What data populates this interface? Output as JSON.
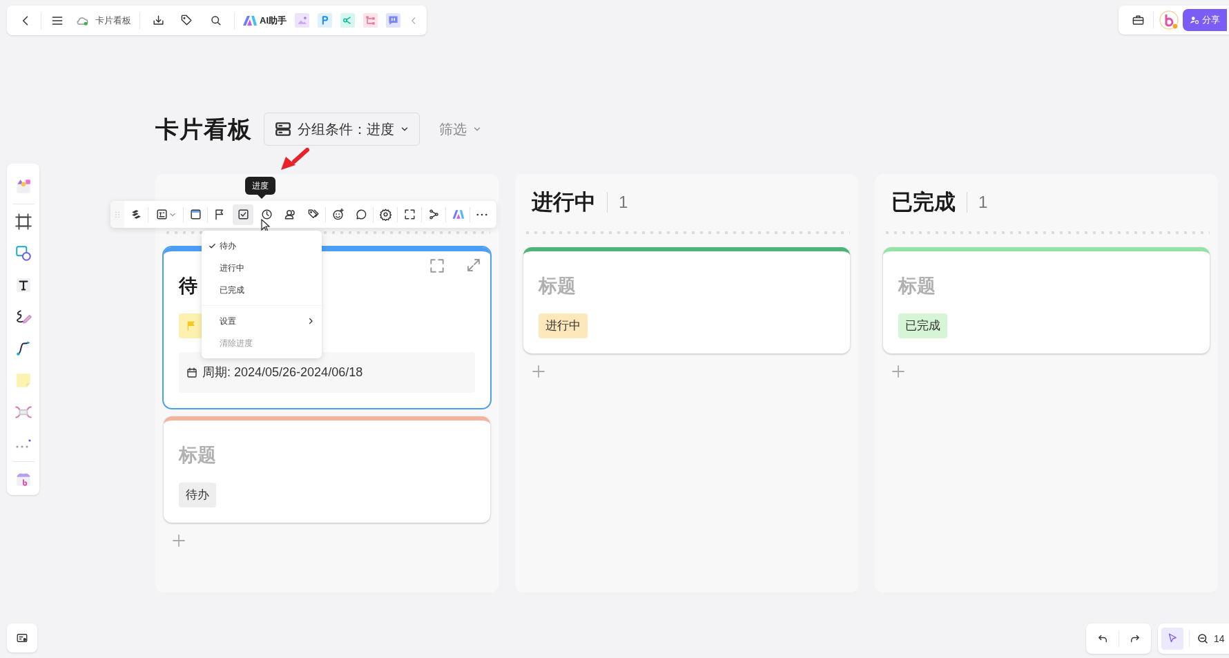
{
  "topbar": {
    "doc_title": "卡片看板",
    "ai_label": "AI助手"
  },
  "share_button": "分享",
  "board": {
    "title": "卡片看板",
    "group_by": "分组条件：进度",
    "filter": "筛选"
  },
  "columns": [
    {
      "cards": [
        {
          "title": "待",
          "color": "#4a9ff5",
          "selected": true,
          "tag": {
            "kind": "flag",
            "color": "#fdf1b0"
          },
          "date": "周期: 2024/05/26-2024/06/18"
        },
        {
          "title": "标题",
          "color": "#f4b39c",
          "selected": false,
          "tag": {
            "kind": "text",
            "label": "待办",
            "color": "#eeeeee"
          }
        }
      ]
    },
    {
      "title": "进行中",
      "count": "1",
      "cards": [
        {
          "title": "标题",
          "color": "#4fb47a",
          "selected": false,
          "tag": {
            "kind": "text",
            "label": "进行中",
            "color": "#fde8bb"
          }
        }
      ]
    },
    {
      "title": "已完成",
      "count": "1",
      "cards": [
        {
          "title": "标题",
          "color": "#95e2a6",
          "selected": false,
          "tag": {
            "kind": "text",
            "label": "已完成",
            "color": "#d5f5d6"
          }
        }
      ]
    }
  ],
  "card_toolbar": {
    "tooltip": "进度",
    "buttons": [
      {
        "selected": false
      },
      {
        "selected": false
      },
      {
        "selected": false
      },
      {
        "selected": false
      },
      {
        "selected": true
      },
      {
        "selected": false
      },
      {
        "selected": false
      },
      {
        "selected": false
      },
      {
        "selected": false
      },
      {
        "selected": false
      },
      {
        "selected": false
      },
      {
        "selected": false
      },
      {
        "selected": false
      },
      {
        "selected": false
      },
      {
        "selected": false
      }
    ]
  },
  "progress_menu": {
    "options": [
      {
        "label": "待办",
        "selected": true
      },
      {
        "label": "进行中",
        "selected": false
      },
      {
        "label": "已完成",
        "selected": false
      }
    ],
    "actions": [
      {
        "label": "设置",
        "submenu": true,
        "disabled": false
      },
      {
        "label": "清除进度",
        "submenu": false,
        "disabled": true
      }
    ]
  },
  "zoom_level": "14"
}
